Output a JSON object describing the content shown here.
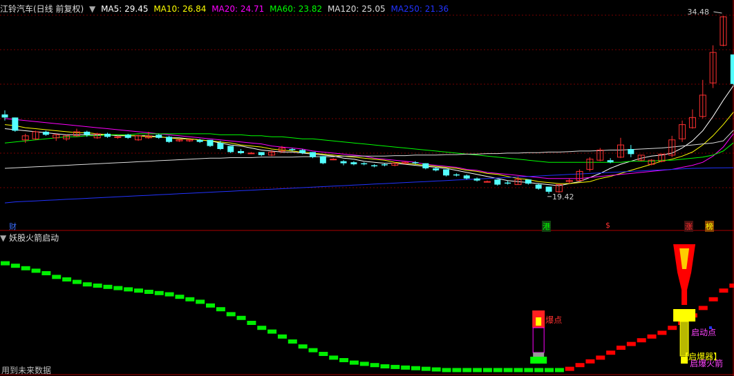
{
  "header": {
    "title": "江铃汽车(日线 前复权)",
    "ma": [
      {
        "label": "MA5: 29.45",
        "color": "#ffffff"
      },
      {
        "label": "MA10: 26.84",
        "color": "#ffff00"
      },
      {
        "label": "MA20: 24.71",
        "color": "#ff00ff"
      },
      {
        "label": "MA60: 23.82",
        "color": "#00ff00"
      },
      {
        "label": "MA120: 25.05",
        "color": "#dddddd"
      },
      {
        "label": "MA250: 21.36",
        "color": "#0000ff"
      }
    ]
  },
  "indicator": {
    "title": "妖股火箭启动",
    "footer": "用到未来数据",
    "labels": {
      "baodian": "爆点",
      "qidongdian": "启动点",
      "qibaoqi": "【启爆器】",
      "qibaohuojian": "启爆火箭"
    }
  },
  "price_labels": {
    "high": "34.48",
    "low": "19.42"
  },
  "event_tags": [
    {
      "text": "财",
      "color": "#1a4fd6",
      "bg": "#000000"
    },
    {
      "text": "港",
      "color": "#00ff00",
      "bg": "#114411"
    },
    {
      "text": "$",
      "color": "#ff3030",
      "bg": "#000000"
    },
    {
      "text": "涨",
      "color": "#ff3030",
      "bg": "#441111"
    },
    {
      "text": "榜",
      "color": "#ffff00",
      "bg": "#884400"
    }
  ],
  "chart_data": {
    "type": "candlestick",
    "ylim": [
      17.5,
      36.5
    ],
    "candles": [
      [
        26.6,
        26.3,
        27.0,
        26.0
      ],
      [
        26.3,
        25.0,
        26.3,
        24.9
      ],
      [
        24.1,
        24.5,
        24.7,
        23.8
      ],
      [
        24.2,
        24.9,
        25.0,
        24.1
      ],
      [
        24.9,
        24.6,
        25.0,
        24.5
      ],
      [
        24.3,
        24.6,
        24.7,
        24.0
      ],
      [
        24.2,
        24.5,
        24.6,
        24.0
      ],
      [
        24.5,
        24.9,
        25.2,
        24.4
      ],
      [
        24.9,
        24.6,
        25.0,
        24.4
      ],
      [
        24.3,
        24.7,
        24.8,
        24.2
      ],
      [
        24.7,
        24.4,
        24.8,
        24.3
      ],
      [
        24.4,
        24.4,
        24.5,
        24.2
      ],
      [
        24.6,
        24.3,
        24.7,
        24.2
      ],
      [
        24.1,
        24.5,
        24.6,
        24.0
      ],
      [
        24.3,
        24.5,
        24.9,
        24.2
      ],
      [
        24.6,
        24.3,
        24.7,
        24.2
      ],
      [
        24.4,
        23.9,
        24.5,
        23.8
      ],
      [
        24.0,
        24.1,
        24.2,
        23.9
      ],
      [
        24.0,
        24.1,
        24.2,
        23.9
      ],
      [
        24.1,
        23.9,
        24.2,
        23.8
      ],
      [
        24.1,
        23.5,
        24.1,
        23.4
      ],
      [
        23.8,
        23.2,
        24.0,
        23.1
      ],
      [
        23.5,
        22.9,
        23.5,
        22.8
      ],
      [
        23.0,
        22.8,
        23.2,
        22.7
      ],
      [
        22.8,
        22.8,
        22.9,
        22.7
      ],
      [
        22.9,
        22.6,
        22.9,
        22.5
      ],
      [
        22.6,
        22.9,
        23.1,
        22.5
      ],
      [
        23.0,
        23.3,
        23.5,
        22.8
      ],
      [
        23.2,
        23.1,
        23.3,
        23.0
      ],
      [
        23.1,
        22.8,
        23.2,
        22.7
      ],
      [
        22.9,
        22.4,
        22.9,
        22.3
      ],
      [
        22.5,
        21.8,
        22.5,
        21.7
      ],
      [
        22.2,
        22.2,
        22.3,
        22.1
      ],
      [
        22.0,
        21.8,
        22.1,
        21.6
      ],
      [
        21.9,
        21.7,
        22.0,
        21.6
      ],
      [
        21.8,
        21.7,
        21.9,
        21.6
      ],
      [
        21.6,
        21.5,
        21.7,
        21.4
      ],
      [
        21.7,
        21.6,
        21.8,
        21.5
      ],
      [
        21.6,
        21.8,
        21.9,
        21.5
      ],
      [
        21.8,
        21.9,
        22.0,
        21.7
      ],
      [
        21.9,
        21.8,
        22.0,
        21.7
      ],
      [
        21.8,
        21.3,
        21.8,
        21.2
      ],
      [
        21.3,
        21.1,
        21.4,
        21.0
      ],
      [
        21.2,
        20.6,
        21.2,
        20.5
      ],
      [
        20.7,
        20.6,
        20.8,
        20.5
      ],
      [
        20.6,
        20.3,
        20.7,
        20.2
      ],
      [
        20.3,
        20.1,
        20.4,
        20.0
      ],
      [
        20.0,
        20.0,
        20.1,
        19.9
      ],
      [
        20.2,
        19.7,
        20.2,
        19.6
      ],
      [
        19.9,
        19.8,
        20.1,
        19.7
      ],
      [
        19.7,
        20.2,
        20.5,
        19.7
      ],
      [
        20.2,
        19.8,
        20.2,
        19.7
      ],
      [
        19.7,
        19.3,
        19.8,
        19.2
      ],
      [
        19.5,
        19.0,
        19.5,
        18.8
      ],
      [
        19.0,
        19.7,
        19.8,
        18.9
      ],
      [
        20.0,
        20.1,
        20.3,
        19.8
      ],
      [
        20.1,
        21.0,
        21.2,
        20.0
      ],
      [
        21.2,
        22.2,
        22.4,
        21.0
      ],
      [
        22.1,
        23.1,
        23.3,
        22.0
      ],
      [
        22.1,
        21.9,
        22.3,
        21.8
      ],
      [
        22.4,
        23.6,
        24.3,
        22.3
      ],
      [
        23.2,
        22.7,
        23.6,
        22.4
      ],
      [
        22.1,
        22.6,
        22.6,
        22.0
      ],
      [
        21.7,
        22.1,
        22.2,
        21.6
      ],
      [
        22.0,
        22.7,
        22.7,
        21.9
      ],
      [
        22.6,
        24.1,
        24.5,
        22.4
      ],
      [
        24.2,
        25.6,
        26.0,
        23.9
      ],
      [
        25.3,
        26.3,
        27.1,
        25.2
      ],
      [
        26.4,
        28.5,
        30.0,
        26.2
      ],
      [
        29.7,
        32.7,
        33.4,
        29.2
      ],
      [
        33.4,
        36.2,
        36.3,
        33.3
      ],
      [
        32.5,
        29.6,
        32.5,
        29.5
      ]
    ],
    "ma_series": {
      "MA5": [
        25.2,
        25.1,
        25.0,
        24.9,
        24.8,
        24.7,
        24.6,
        24.6,
        24.6,
        24.6,
        24.6,
        24.5,
        24.5,
        24.5,
        24.5,
        24.4,
        24.3,
        24.3,
        24.2,
        24.1,
        24.0,
        23.8,
        23.6,
        23.5,
        23.3,
        23.1,
        23.0,
        22.9,
        22.9,
        22.8,
        22.7,
        22.6,
        22.5,
        22.3,
        22.2,
        22.0,
        21.9,
        21.8,
        21.8,
        21.7,
        21.6,
        21.5,
        21.4,
        21.3,
        21.1,
        20.9,
        20.7,
        20.5,
        20.3,
        20.1,
        20.0,
        19.9,
        19.8,
        19.7,
        19.6,
        19.8,
        20.0,
        20.4,
        20.8,
        21.3,
        21.7,
        22.0,
        22.3,
        22.5,
        22.6,
        22.8,
        23.3,
        24.0,
        25.0,
        26.4,
        28.0,
        29.45
      ],
      "MA10": [
        25.6,
        25.5,
        25.3,
        25.2,
        25.1,
        25.0,
        24.9,
        24.8,
        24.8,
        24.7,
        24.6,
        24.6,
        24.5,
        24.5,
        24.4,
        24.4,
        24.3,
        24.2,
        24.2,
        24.1,
        24.0,
        23.9,
        23.8,
        23.6,
        23.5,
        23.4,
        23.2,
        23.1,
        23.0,
        22.9,
        22.8,
        22.7,
        22.6,
        22.5,
        22.4,
        22.3,
        22.2,
        22.1,
        21.9,
        21.8,
        21.7,
        21.6,
        21.5,
        21.4,
        21.3,
        21.1,
        21.0,
        20.8,
        20.7,
        20.5,
        20.3,
        20.2,
        20.0,
        19.9,
        19.8,
        19.8,
        19.9,
        20.0,
        20.3,
        20.5,
        20.8,
        21.1,
        21.4,
        21.7,
        22.0,
        22.2,
        22.5,
        22.9,
        23.6,
        24.5,
        25.6,
        26.84
      ],
      "MA20": [
        26.2,
        26.1,
        26.0,
        25.9,
        25.8,
        25.7,
        25.6,
        25.5,
        25.4,
        25.3,
        25.2,
        25.1,
        25.0,
        24.9,
        24.8,
        24.7,
        24.6,
        24.5,
        24.4,
        24.3,
        24.2,
        24.1,
        24.0,
        23.9,
        23.8,
        23.7,
        23.5,
        23.4,
        23.3,
        23.2,
        23.0,
        22.9,
        22.8,
        22.7,
        22.6,
        22.5,
        22.3,
        22.2,
        22.1,
        22.0,
        21.9,
        21.7,
        21.6,
        21.5,
        21.4,
        21.2,
        21.1,
        20.9,
        20.8,
        20.7,
        20.6,
        20.5,
        20.4,
        20.3,
        20.3,
        20.3,
        20.3,
        20.4,
        20.5,
        20.6,
        20.7,
        20.8,
        20.9,
        21.0,
        21.1,
        21.2,
        21.4,
        21.6,
        21.9,
        22.5,
        23.4,
        24.71
      ],
      "MA60": [
        23.8,
        23.9,
        24.0,
        24.1,
        24.2,
        24.3,
        24.4,
        24.4,
        24.5,
        24.5,
        24.6,
        24.6,
        24.6,
        24.7,
        24.7,
        24.7,
        24.7,
        24.7,
        24.7,
        24.7,
        24.7,
        24.6,
        24.6,
        24.6,
        24.5,
        24.5,
        24.4,
        24.4,
        24.3,
        24.2,
        24.2,
        24.1,
        24.0,
        23.9,
        23.8,
        23.7,
        23.6,
        23.5,
        23.4,
        23.3,
        23.2,
        23.1,
        23.0,
        22.9,
        22.8,
        22.7,
        22.6,
        22.5,
        22.4,
        22.3,
        22.2,
        22.1,
        22.0,
        21.9,
        21.9,
        21.9,
        21.9,
        21.9,
        21.9,
        21.9,
        21.9,
        22.0,
        22.0,
        22.0,
        22.1,
        22.1,
        22.2,
        22.3,
        22.4,
        22.6,
        23.0,
        23.82
      ],
      "MA120": [
        21.3,
        21.35,
        21.4,
        21.45,
        21.5,
        21.55,
        21.6,
        21.65,
        21.7,
        21.75,
        21.8,
        21.85,
        21.9,
        21.95,
        22.0,
        22.05,
        22.1,
        22.15,
        22.2,
        22.25,
        22.3,
        22.3,
        22.35,
        22.35,
        22.35,
        22.4,
        22.4,
        22.4,
        22.4,
        22.45,
        22.45,
        22.45,
        22.45,
        22.5,
        22.5,
        22.5,
        22.5,
        22.5,
        22.55,
        22.55,
        22.6,
        22.6,
        22.6,
        22.65,
        22.65,
        22.7,
        22.7,
        22.75,
        22.75,
        22.8,
        22.8,
        22.85,
        22.85,
        22.9,
        22.9,
        22.95,
        23.0,
        23.0,
        23.05,
        23.1,
        23.1,
        23.15,
        23.2,
        23.25,
        23.3,
        23.4,
        23.5,
        23.6,
        23.7,
        23.8,
        24.0,
        25.05
      ],
      "MA250": [
        17.9,
        18.0,
        18.05,
        18.1,
        18.15,
        18.2,
        18.25,
        18.3,
        18.35,
        18.4,
        18.45,
        18.5,
        18.55,
        18.6,
        18.65,
        18.7,
        18.75,
        18.8,
        18.85,
        18.9,
        18.95,
        19.0,
        19.05,
        19.1,
        19.15,
        19.2,
        19.25,
        19.3,
        19.35,
        19.4,
        19.45,
        19.5,
        19.55,
        19.6,
        19.65,
        19.7,
        19.75,
        19.8,
        19.85,
        19.9,
        19.95,
        20.0,
        20.05,
        20.1,
        20.15,
        20.2,
        20.25,
        20.3,
        20.35,
        20.4,
        20.45,
        20.5,
        20.55,
        20.6,
        20.65,
        20.7,
        20.75,
        20.8,
        20.85,
        20.9,
        20.95,
        21.0,
        21.05,
        21.1,
        21.15,
        21.2,
        21.25,
        21.3,
        21.32,
        21.34,
        21.35,
        21.36
      ]
    },
    "indicator_line": [
      0.88,
      0.86,
      0.84,
      0.82,
      0.8,
      0.77,
      0.75,
      0.73,
      0.71,
      0.7,
      0.69,
      0.68,
      0.67,
      0.66,
      0.65,
      0.64,
      0.63,
      0.61,
      0.59,
      0.57,
      0.54,
      0.51,
      0.47,
      0.44,
      0.4,
      0.36,
      0.33,
      0.29,
      0.25,
      0.21,
      0.18,
      0.15,
      0.12,
      0.1,
      0.08,
      0.07,
      0.06,
      0.05,
      0.045,
      0.04,
      0.035,
      0.03,
      0.025,
      0.02,
      0.02,
      0.02,
      0.02,
      0.02,
      0.02,
      0.02,
      0.02,
      0.02,
      0.02,
      0.02,
      0.02,
      0.03,
      0.06,
      0.09,
      0.12,
      0.16,
      0.2,
      0.23,
      0.26,
      0.29,
      0.32,
      0.36,
      0.4,
      0.46,
      0.52,
      0.59,
      0.66,
      0.7
    ]
  }
}
